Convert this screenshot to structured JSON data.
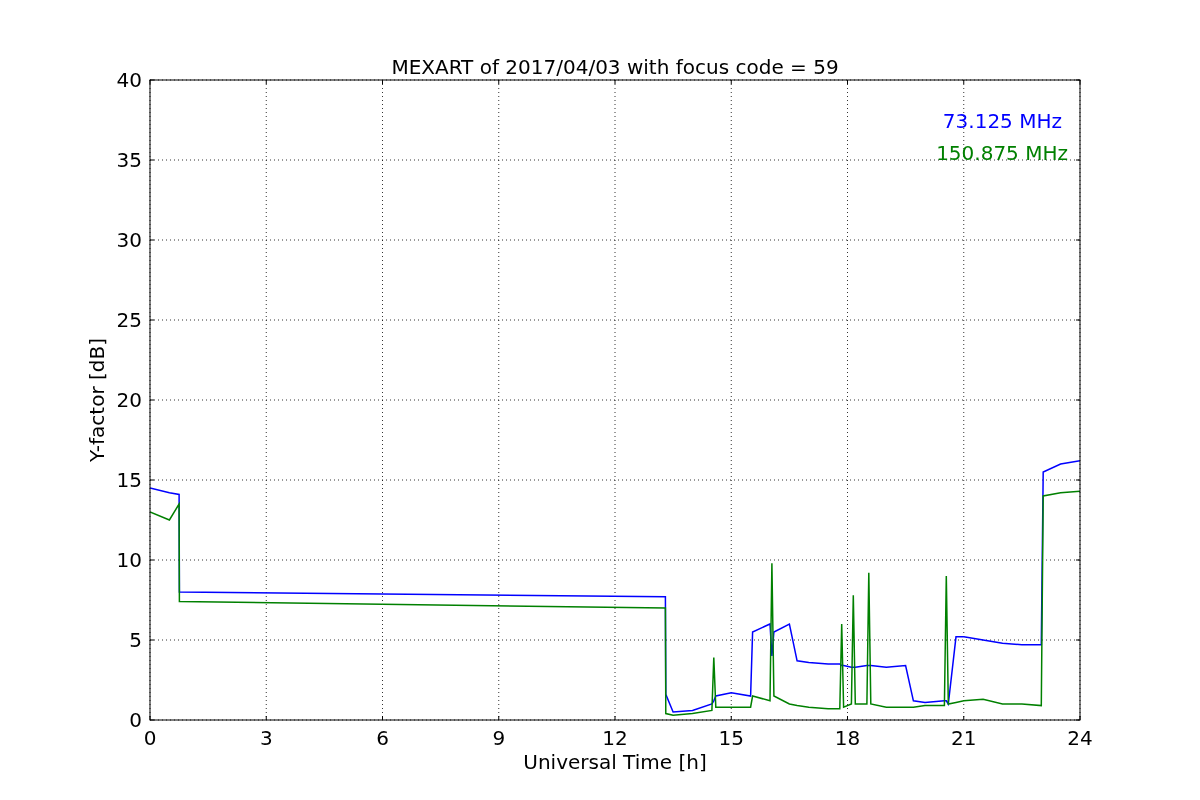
{
  "chart_data": {
    "type": "line",
    "title": "MEXART of 2017/04/03 with focus code = 59",
    "xlabel": "Universal Time [h]",
    "ylabel": "Y-factor [dB]",
    "x": [
      0,
      0.5,
      0.75,
      0.76,
      13.3,
      13.31,
      13.5,
      14,
      14.5,
      14.55,
      14.6,
      15,
      15.5,
      15.55,
      16,
      16.05,
      16.1,
      16.5,
      16.7,
      17,
      17.5,
      17.8,
      17.85,
      17.9,
      18.1,
      18.15,
      18.2,
      18.5,
      18.55,
      18.6,
      19,
      19.5,
      19.7,
      20,
      20.5,
      20.55,
      20.6,
      20.8,
      21,
      21.5,
      22,
      22.5,
      23,
      23.05,
      23.5,
      24
    ],
    "series": [
      {
        "name": "73.125 MHz",
        "color": "#0000ff",
        "values": [
          14.5,
          14.2,
          14.1,
          8.0,
          7.7,
          1.6,
          0.5,
          0.6,
          1.0,
          1.2,
          1.5,
          1.7,
          1.5,
          5.5,
          6,
          4,
          5.5,
          6,
          3.7,
          3.6,
          3.5,
          3.5,
          3.4,
          3.4,
          3.3,
          3.3,
          3.3,
          3.4,
          3.4,
          3.4,
          3.3,
          3.4,
          1.2,
          1.1,
          1.2,
          1.2,
          1.0,
          5.2,
          5.2,
          5.0,
          4.8,
          4.7,
          4.7,
          15.5,
          16.0,
          16.2
        ]
      },
      {
        "name": "150.875 MHz",
        "color": "#008000",
        "values": [
          13,
          12.5,
          13.5,
          7.4,
          7.0,
          0.4,
          0.3,
          0.4,
          0.6,
          3.9,
          0.8,
          0.8,
          0.8,
          1.5,
          1.2,
          9.8,
          1.5,
          1.0,
          0.9,
          0.8,
          0.7,
          0.7,
          6.0,
          0.8,
          1.0,
          7.8,
          1.0,
          1.0,
          9.2,
          1.0,
          0.8,
          0.8,
          0.8,
          0.9,
          0.9,
          9.0,
          1.0,
          1.1,
          1.2,
          1.3,
          1.0,
          1.0,
          0.9,
          14.0,
          14.2,
          14.3
        ]
      }
    ],
    "xlim": [
      0,
      24
    ],
    "ylim": [
      0,
      40
    ],
    "xticks": [
      0,
      3,
      6,
      9,
      12,
      15,
      18,
      21,
      24
    ],
    "yticks": [
      0,
      5,
      10,
      15,
      20,
      25,
      30,
      35,
      40
    ],
    "grid": true
  }
}
